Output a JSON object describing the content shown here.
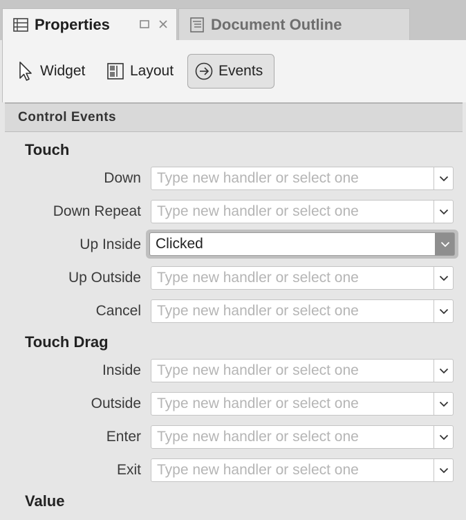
{
  "tabs": {
    "properties_label": "Properties",
    "outline_label": "Document Outline"
  },
  "toolbar": {
    "widget_label": "Widget",
    "layout_label": "Layout",
    "events_label": "Events"
  },
  "section": {
    "title": "Control Events"
  },
  "groups": {
    "touch": "Touch",
    "touch_drag": "Touch Drag",
    "value": "Value"
  },
  "placeholder": "Type new handler or select one",
  "rows": {
    "down": {
      "label": "Down",
      "value": ""
    },
    "down_repeat": {
      "label": "Down Repeat",
      "value": ""
    },
    "up_inside": {
      "label": "Up Inside",
      "value": "Clicked"
    },
    "up_outside": {
      "label": "Up Outside",
      "value": ""
    },
    "cancel": {
      "label": "Cancel",
      "value": ""
    },
    "drag_inside": {
      "label": "Inside",
      "value": ""
    },
    "drag_outside": {
      "label": "Outside",
      "value": ""
    },
    "drag_enter": {
      "label": "Enter",
      "value": ""
    },
    "drag_exit": {
      "label": "Exit",
      "value": ""
    }
  },
  "icons": {
    "properties": "properties-list-icon",
    "outline": "document-outline-icon",
    "widget": "cursor-arrow-icon",
    "layout": "layout-grid-icon",
    "events": "arrow-circle-icon",
    "dropdown": "chevron-down-icon"
  },
  "colors": {
    "focused_dropdown": "#8e8e8e",
    "placeholder": "#b5b5b5"
  }
}
